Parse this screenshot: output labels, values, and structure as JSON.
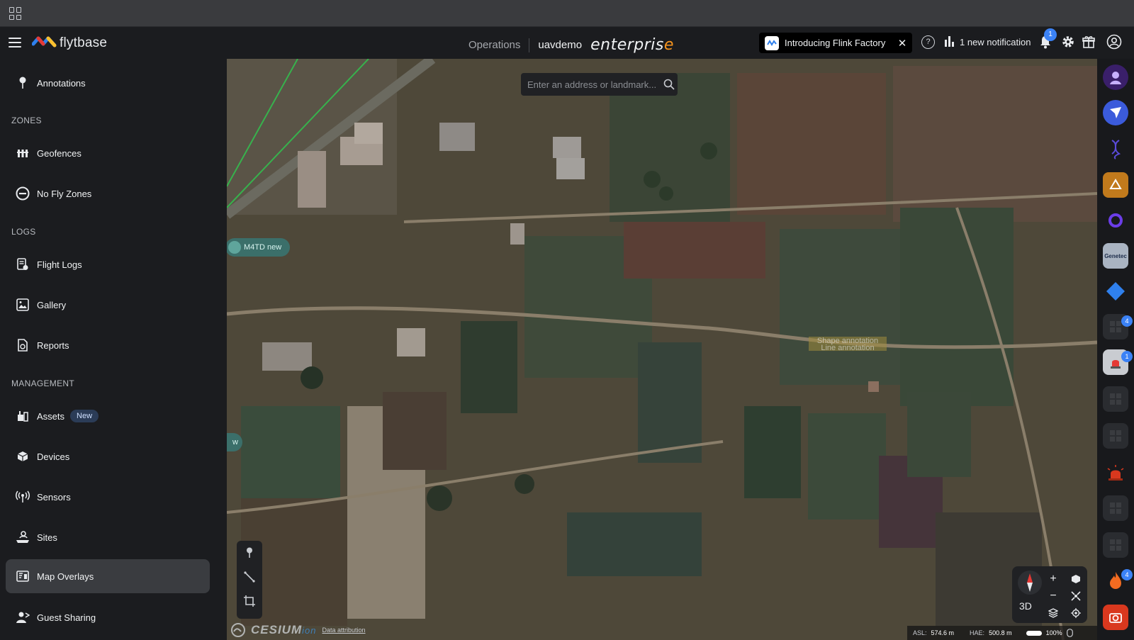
{
  "app": {
    "brand": "flytbase",
    "nav_operations": "Operations",
    "org_name": "uavdemo",
    "tier": "enterpris",
    "tier_last_letter": "e"
  },
  "promo": {
    "text": "Introducing Flink Factory",
    "close": "✕"
  },
  "header": {
    "notification_text": "1 new notification",
    "notification_count": "1"
  },
  "sidebar": {
    "annotations": "Annotations",
    "zones_heading": "ZONES",
    "geofences": "Geofences",
    "no_fly_zones": "No Fly Zones",
    "logs_heading": "LOGS",
    "flight_logs": "Flight Logs",
    "gallery": "Gallery",
    "reports": "Reports",
    "management_heading": "MANAGEMENT",
    "assets": "Assets",
    "assets_badge": "New",
    "devices": "Devices",
    "sensors": "Sensors",
    "sites": "Sites",
    "map_overlays": "Map Overlays",
    "guest_sharing": "Guest Sharing",
    "active_item": "Map Overlays"
  },
  "map": {
    "search_placeholder": "Enter an address or landmark...",
    "asset_label": "M4TD new",
    "asset_label_2": "w",
    "annotation_shape": "Shape annotation",
    "annotation_line": "Line annotation",
    "cesium_brand": "CESIUM",
    "cesium_suffix": "ion",
    "data_attribution": "Data attribution",
    "mode": "3D",
    "zoom_in": "+",
    "zoom_out": "−",
    "asl_label": "ASL:",
    "asl_value": "574.6 m",
    "hae_label": "HAE:",
    "hae_value": "500.8 m",
    "zoom_percent": "100%"
  },
  "rail": {
    "badges": [
      "4",
      "1",
      "4"
    ],
    "genetec_label": "Genetec"
  },
  "colors": {
    "accent": "#3b82f6",
    "brand_orange": "#f7941d",
    "sidebar_bg": "#1b1c1f",
    "active_bg": "#3a3c40"
  }
}
